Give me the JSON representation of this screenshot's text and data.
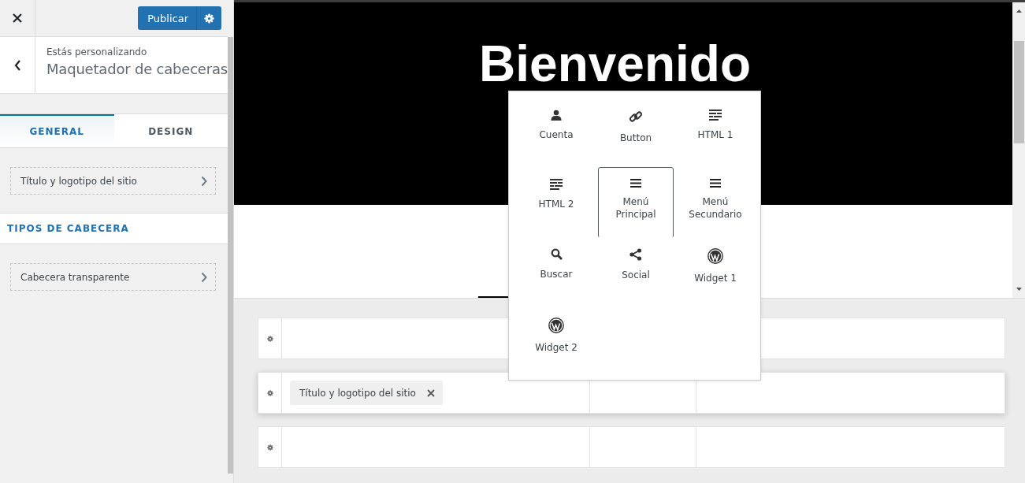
{
  "sidebar": {
    "publish_button": "Publicar",
    "breadcrumb": "Estás personalizando",
    "title": "Maquetador de cabeceras",
    "tabs": [
      {
        "label": "GENERAL",
        "selected": true
      },
      {
        "label": "DESIGN",
        "selected": false
      }
    ],
    "general_links": [
      "Título y logotipo del sitio"
    ],
    "section_heading": "TIPOS DE CABECERA",
    "type_links": [
      "Cabecera transparente"
    ]
  },
  "preview": {
    "heading": "Bienvenido"
  },
  "builder_rows": [
    {
      "selected": false
    },
    {
      "selected": true,
      "left_items": [
        "Título y logotipo del sitio"
      ]
    },
    {
      "selected": false
    }
  ],
  "element_picker": [
    {
      "kind": "person",
      "label": "Cuenta",
      "selected": false
    },
    {
      "kind": "link",
      "label": "Button",
      "selected": false
    },
    {
      "kind": "text",
      "label": "HTML 1",
      "selected": false
    },
    {
      "kind": "text",
      "label": "HTML 2",
      "selected": false
    },
    {
      "kind": "menu",
      "label": "Menú Principal",
      "selected": true
    },
    {
      "kind": "menu",
      "label": "Menú Secundario",
      "selected": false
    },
    {
      "kind": "search",
      "label": "Buscar",
      "selected": false
    },
    {
      "kind": "share",
      "label": "Social",
      "selected": false
    },
    {
      "kind": "wp",
      "label": "Widget 1",
      "selected": false
    },
    {
      "kind": "wp",
      "label": "Widget 2",
      "selected": false
    }
  ]
}
